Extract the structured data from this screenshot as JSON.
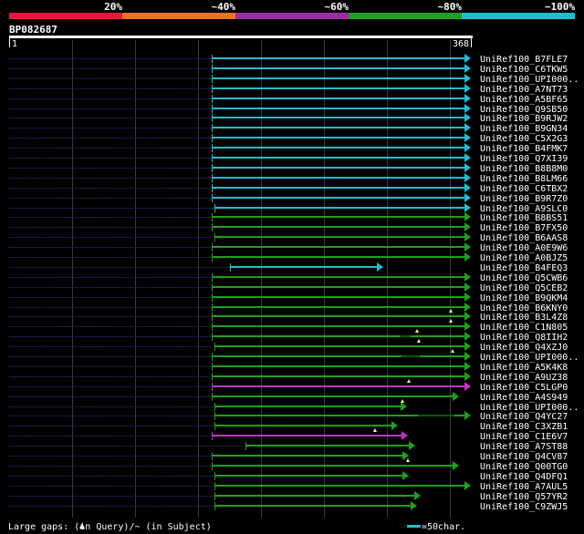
{
  "identity_scale": {
    "labels": [
      "20%",
      "~40%",
      "~60%",
      "~80%",
      "~100%"
    ],
    "colors": [
      "#e8173a",
      "#e8741c",
      "#9b2ea0",
      "#1ea01e",
      "#22bcd0"
    ]
  },
  "query": {
    "name": "BP082687",
    "start": "1",
    "end": "368"
  },
  "legend": {
    "gaps_text": "Large gaps:  (in Query)/~ (in Subject)",
    "scale_text": "=50char.",
    "scale_color": "#22bcd0"
  },
  "hits": [
    {
      "id": "UniRef100_B7FLE7",
      "color": "#22bcd0"
    },
    {
      "id": "UniRef100_C6TKW5",
      "color": "#22bcd0"
    },
    {
      "id": "UniRef100_UPI000..",
      "color": "#22bcd0"
    },
    {
      "id": "UniRef100_A7NT73",
      "color": "#22bcd0"
    },
    {
      "id": "UniRef100_A5BF65",
      "color": "#22bcd0"
    },
    {
      "id": "UniRef100_Q9SB50",
      "color": "#22bcd0"
    },
    {
      "id": "UniRef100_B9RJW2",
      "color": "#22bcd0"
    },
    {
      "id": "UniRef100_B9GN34",
      "color": "#22bcd0"
    },
    {
      "id": "UniRef100_C5X2G3",
      "color": "#22bcd0"
    },
    {
      "id": "UniRef100_B4FMK7",
      "color": "#22bcd0"
    },
    {
      "id": "UniRef100_Q7XI39",
      "color": "#22bcd0"
    },
    {
      "id": "UniRef100_B8B8M0",
      "color": "#22bcd0"
    },
    {
      "id": "UniRef100_B8LM66",
      "color": "#22bcd0"
    },
    {
      "id": "UniRef100_C6TBX2",
      "color": "#22bcd0"
    },
    {
      "id": "UniRef100_B9R7Z0",
      "color": "#22bcd0"
    },
    {
      "id": "UniRef100_A9SLC0",
      "color": "#22bcd0"
    },
    {
      "id": "UniRef100_B8BS51",
      "color": "#1ea01e"
    },
    {
      "id": "UniRef100_B7FX50",
      "color": "#1ea01e"
    },
    {
      "id": "UniRef100_B6AAS8",
      "color": "#1ea01e"
    },
    {
      "id": "UniRef100_A0E9W6",
      "color": "#1ea01e"
    },
    {
      "id": "UniRef100_A0BJZ5",
      "color": "#1ea01e"
    },
    {
      "id": "UniRef100_B4FEQ3",
      "color": "#22bcd0"
    },
    {
      "id": "UniRef100_Q5CWB6",
      "color": "#1ea01e"
    },
    {
      "id": "UniRef100_Q5CEB2",
      "color": "#1ea01e"
    },
    {
      "id": "UniRef100_B9QKM4",
      "color": "#1ea01e"
    },
    {
      "id": "UniRef100_B6KNY0",
      "color": "#1ea01e"
    },
    {
      "id": "UniRef100_B3L4Z8",
      "color": "#1ea01e"
    },
    {
      "id": "UniRef100_C1N805",
      "color": "#1ea01e"
    },
    {
      "id": "UniRef100_Q8IIH2",
      "color": "#1ea01e"
    },
    {
      "id": "UniRef100_Q4XZJ0",
      "color": "#1ea01e"
    },
    {
      "id": "UniRef100_UPI000..",
      "color": "#1ea01e"
    },
    {
      "id": "UniRef100_A5K4K8",
      "color": "#1ea01e"
    },
    {
      "id": "UniRef100_A9UZ38",
      "color": "#1ea01e"
    },
    {
      "id": "UniRef100_C5LGP0",
      "color": "#c034c8"
    },
    {
      "id": "UniRef100_A4S949",
      "color": "#1ea01e"
    },
    {
      "id": "UniRef100_UPI000..",
      "color": "#1ea01e"
    },
    {
      "id": "UniRef100_Q4YC27",
      "color": "#1ea01e"
    },
    {
      "id": "UniRef100_C3XZB1",
      "color": "#1ea01e"
    },
    {
      "id": "UniRef100_C1E6V7",
      "color": "#c034c8"
    },
    {
      "id": "UniRef100_A7ST88",
      "color": "#1ea01e"
    },
    {
      "id": "UniRef100_Q4CV87",
      "color": "#1ea01e"
    },
    {
      "id": "UniRef100_Q00TG0",
      "color": "#1ea01e"
    },
    {
      "id": "UniRef100_Q4DFQ1",
      "color": "#1ea01e"
    },
    {
      "id": "UniRef100_A7AUL5",
      "color": "#1ea01e"
    },
    {
      "id": "UniRef100_Q57YR2",
      "color": "#1ea01e"
    },
    {
      "id": "UniRef100_C9ZWJ5",
      "color": "#1ea01e"
    }
  ]
}
